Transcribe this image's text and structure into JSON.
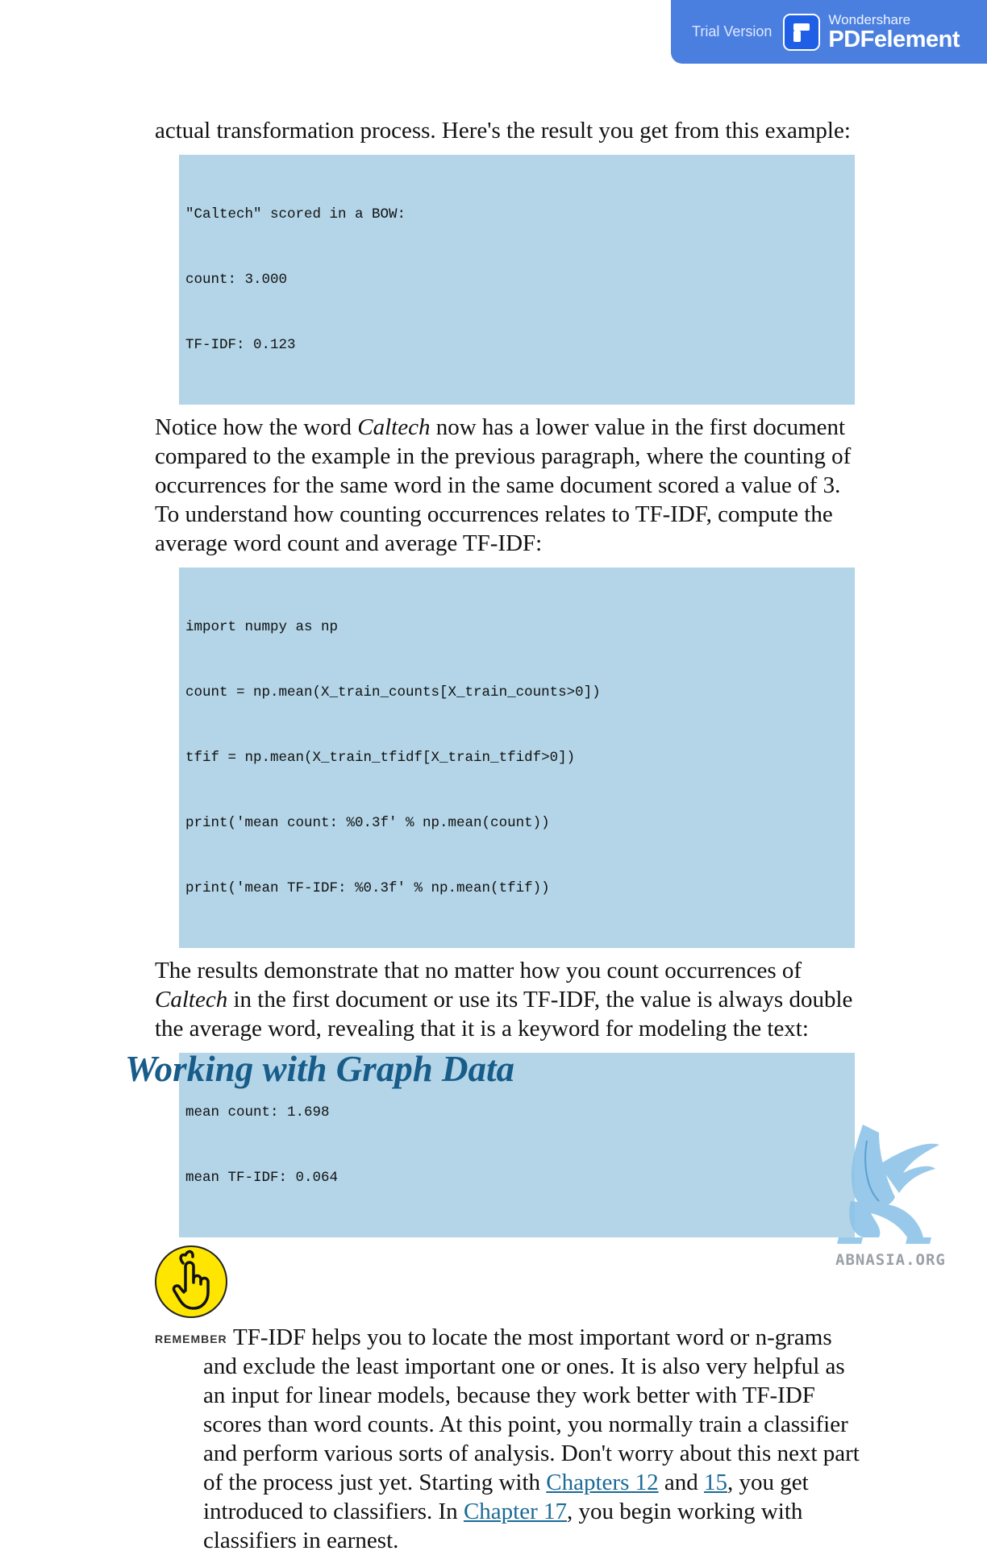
{
  "badge": {
    "trial_label": "Trial Version",
    "brand_maker": "Wondershare",
    "brand_product": "PDFelement",
    "color": "#4a7fe0"
  },
  "paragraphs": {
    "p1": "actual transformation process. Here's the result you get from this example:",
    "p2_before": "Notice how the word ",
    "p2_em": "Caltech",
    "p2_after": " now has a lower value in the first document compared to the example in the previous paragraph, where the counting of occurrences for the same word in the same document scored a value of 3. To understand how counting occurrences relates to TF-IDF, compute the average word count and average TF-IDF:",
    "p3_before": "The results demonstrate that no matter how you count occurrences of ",
    "p3_em": "Caltech",
    "p3_after": " in the first document or use its TF-IDF, the value is always double the average word, revealing that it is a keyword for modeling the text:"
  },
  "code_blocks": {
    "block1": [
      "\"Caltech\" scored in a BOW:",
      "count: 3.000",
      "TF-IDF: 0.123"
    ],
    "block2": [
      "import numpy as np",
      "count = np.mean(X_train_counts[X_train_counts>0])",
      "tfif = np.mean(X_train_tfidf[X_train_tfidf>0])",
      "print('mean count: %0.3f' % np.mean(count))",
      "print('mean TF-IDF: %0.3f' % np.mean(tfif))"
    ],
    "block3": [
      "mean count: 1.698",
      "mean TF-IDF: 0.064"
    ]
  },
  "remember": {
    "icon": "pointing-finger-icon",
    "label": "REMEMBER",
    "t1": "TF-IDF helps you to locate the most important word or n-grams and exclude the least important one or ones. It is also very helpful as an input for linear models, because they work better with TF-IDF scores than word counts. At this point, you normally train a classifier and perform various sorts of analysis. Don't worry about this next part of the process just yet. Starting with ",
    "link1": "Chapters 12",
    "t2": " and ",
    "link2": "15",
    "t3": ", you get introduced to classifiers. In ",
    "link3": "Chapter 17",
    "t4": ", you begin working with classifiers in earnest."
  },
  "section_heading": "Working with Graph Data",
  "watermark": {
    "icon": "griffin-logo-icon",
    "text": "ABNASIA.ORG"
  }
}
